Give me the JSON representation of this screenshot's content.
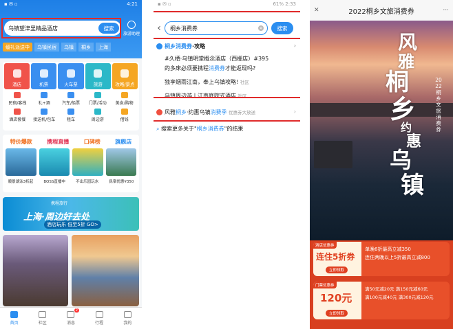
{
  "panel1": {
    "time": "4:21",
    "search_text": "乌镇望津里精品酒店",
    "search_button": "搜索",
    "travel_assistant": "旅游助理",
    "chips": [
      "缓礼派送中",
      "乌镇民宿",
      "乌镇",
      "桐乡",
      "上海"
    ],
    "big_tiles": [
      {
        "label": "酒店",
        "color": "#f0534a"
      },
      {
        "label": "机票",
        "color": "#3a8ff0"
      },
      {
        "label": "火车票",
        "color": "#3a8ff0"
      },
      {
        "label": "旅游",
        "color": "#2bb8c8"
      },
      {
        "label": "攻略/景点",
        "color": "#f5a623"
      }
    ],
    "small_row1": [
      "民宿/客栈",
      "礼+酒",
      "汽车/船票",
      "门票/活动",
      "美食/购物"
    ],
    "small_row2": [
      "酒店套餐",
      "接送机/包车",
      "租车",
      "周边游",
      "借钱"
    ],
    "promo_titles": [
      "特价爆款",
      "携程直播",
      "口碑榜",
      "旗舰店"
    ],
    "promo_captions": [
      "限时特价",
      "暑期大促",
      "手心旅行",
      "夏日省钱"
    ],
    "promo_subs": [
      "顺景湖泳3折起",
      "BOSS直播中",
      "不出乐园玩水",
      "民宿优惠¥350"
    ],
    "banner_text": "上海·周边好去处",
    "banner_sub": "酒店玩乐 低至5折 GO>",
    "banner_brand": "携程旅行",
    "tabs": [
      "首页",
      "社区",
      "消息",
      "行程",
      "我的"
    ],
    "msg_badge": "2"
  },
  "panel2": {
    "time": "2:33",
    "battery": "61%",
    "search_text": "桐乡消费券",
    "search_button": "搜索",
    "s1_title_a": "桐乡消费券",
    "s1_title_b": "·攻略",
    "s1_line1": "#久栖·乌镇明堂概念酒店（西栅店）#395",
    "s1_line2a": "的多床必须要携程",
    "s1_line2b": "消费券",
    "s1_line2c": "才能返现吗?",
    "s1_line3": "独享烟雨江南，奉上乌镇攻略!",
    "s1_line3_tag": "社区",
    "s1_line4": "乌镇周边游丨江南庭院式酒店",
    "s1_line4_tag": "社区",
    "s2_a": "风雅",
    "s2_b": "桐乡",
    "s2_c": "·约惠乌镇",
    "s2_d": "消费季",
    "s2_tag": "优惠券大放送",
    "s3_a": "搜索更多关于\"",
    "s3_b": "桐乡消费券",
    "s3_c": "\"的结果"
  },
  "panel3": {
    "title": "2022桐乡文旅消费券",
    "close": "✕",
    "more": "···",
    "callig": [
      "风",
      "雅",
      "桐",
      "乡",
      "约",
      "惠",
      "乌",
      "镇"
    ],
    "vertical_title": "2022桐乡文旅消费券",
    "coupon1_label": "酒店优惠券",
    "coupon1_main": "连住5折券",
    "coupon1_btn": "立即领取",
    "coupon1_r1": "单晚6折最高立减350",
    "coupon1_r2": "连住两晚以上5折最高立减800",
    "coupon2_label": "门票优惠券",
    "coupon2_main": "120元",
    "coupon2_btn": "立即领取",
    "coupon2_r1": "满50元减20元  满150元减60元",
    "coupon2_r2": "满100元减40元  满300元减120元"
  }
}
